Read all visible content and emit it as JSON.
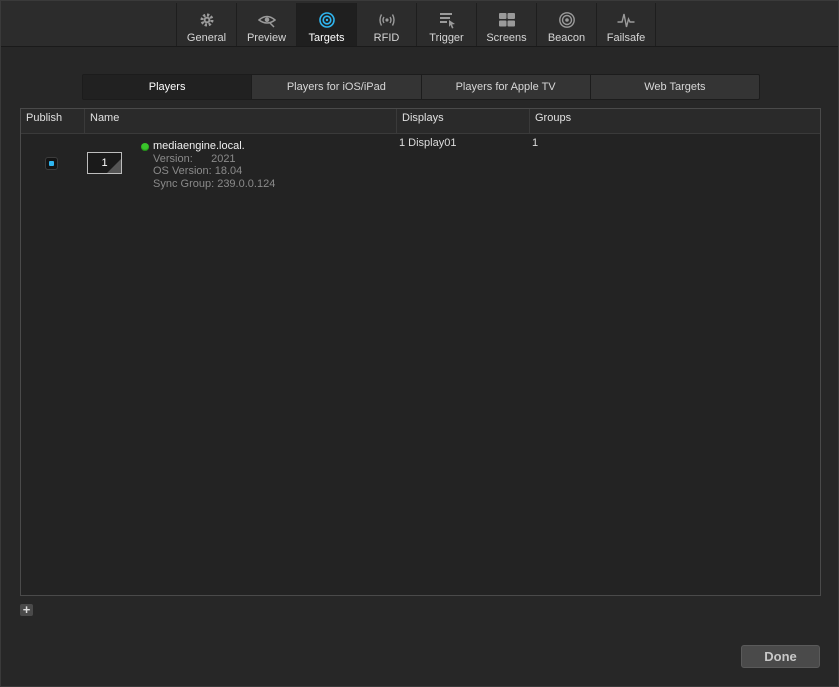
{
  "toolbar": {
    "items": [
      {
        "label": "General",
        "icon": "gear-icon"
      },
      {
        "label": "Preview",
        "icon": "eye-icon"
      },
      {
        "label": "Targets",
        "icon": "target-icon",
        "active": true
      },
      {
        "label": "RFID",
        "icon": "rfid-icon"
      },
      {
        "label": "Trigger",
        "icon": "trigger-icon"
      },
      {
        "label": "Screens",
        "icon": "screens-icon"
      },
      {
        "label": "Beacon",
        "icon": "beacon-icon"
      },
      {
        "label": "Failsafe",
        "icon": "failsafe-icon"
      }
    ]
  },
  "tabs": [
    {
      "label": "Players",
      "active": true
    },
    {
      "label": "Players for iOS/iPad"
    },
    {
      "label": "Players for Apple TV"
    },
    {
      "label": "Web Targets"
    }
  ],
  "table": {
    "columns": [
      "Publish",
      "Name",
      "Displays",
      "Groups"
    ],
    "rows": [
      {
        "published": true,
        "number": "1",
        "status_color": "#39c42a",
        "host": "mediaengine.local.",
        "version_line": "Version:      2021",
        "os_line": "OS Version: 18.04",
        "sync_line": "Sync Group: 239.0.0.124",
        "displays": "1 Display01",
        "groups": "1"
      }
    ]
  },
  "footer": {
    "add_label": "+",
    "done_label": "Done"
  },
  "colors": {
    "accent": "#2fb6f0",
    "status_online": "#39c42a"
  }
}
